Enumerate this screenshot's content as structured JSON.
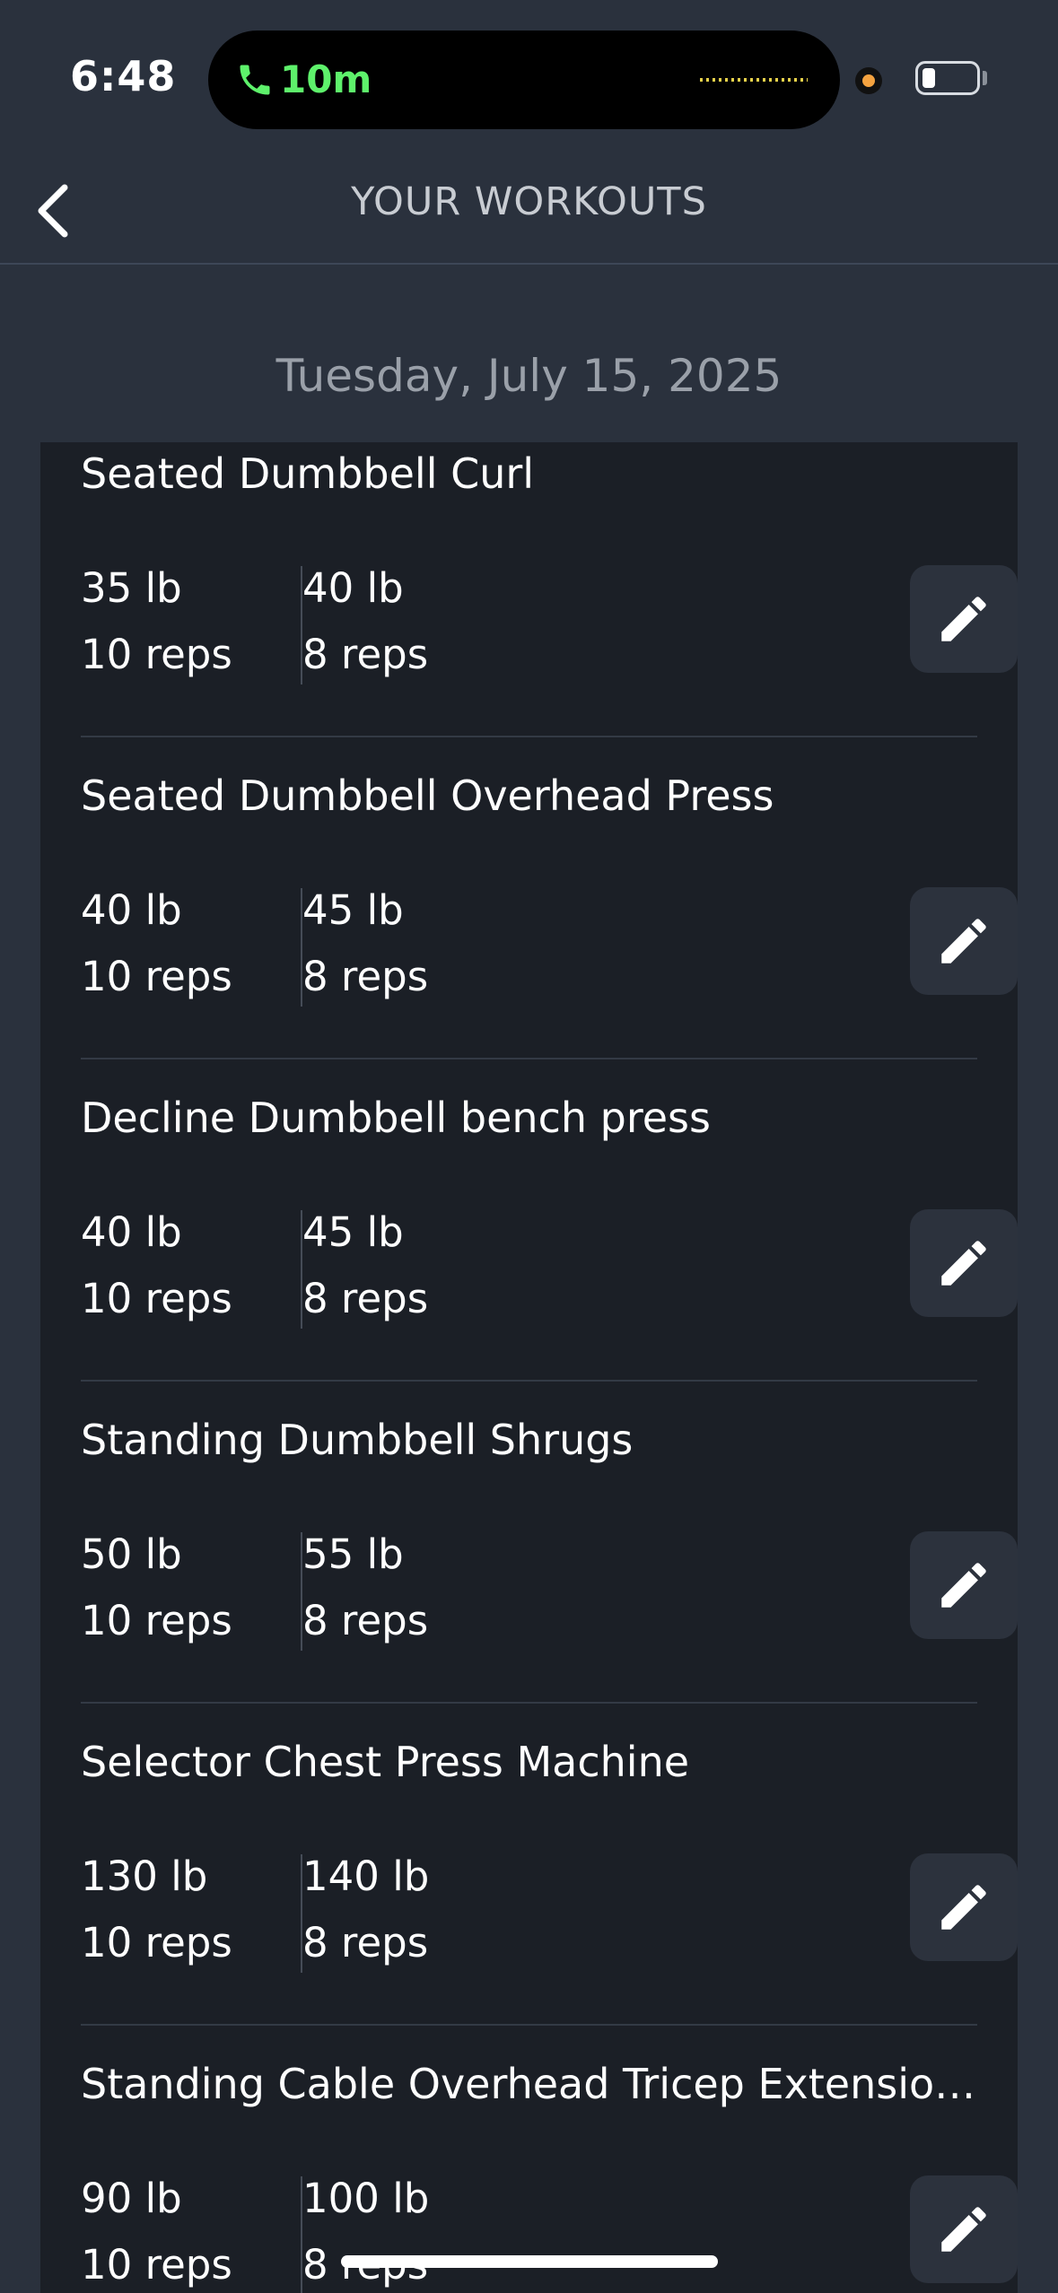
{
  "status_bar": {
    "time": "6:48",
    "call_duration": "10m"
  },
  "nav": {
    "title": "YOUR WORKOUTS"
  },
  "date": "Tuesday, July 15, 2025",
  "workouts": [
    {
      "name": "Seated Dumbbell Curl",
      "sets": [
        {
          "weight": "35 lb",
          "reps": "10 reps"
        },
        {
          "weight": "40 lb",
          "reps": "8 reps"
        }
      ]
    },
    {
      "name": "Seated Dumbbell Overhead Press",
      "sets": [
        {
          "weight": "40 lb",
          "reps": "10 reps"
        },
        {
          "weight": "45 lb",
          "reps": "8 reps"
        }
      ]
    },
    {
      "name": "Decline Dumbbell bench press",
      "sets": [
        {
          "weight": "40 lb",
          "reps": "10 reps"
        },
        {
          "weight": "45 lb",
          "reps": "8 reps"
        }
      ]
    },
    {
      "name": "Standing Dumbbell Shrugs",
      "sets": [
        {
          "weight": "50 lb",
          "reps": "10 reps"
        },
        {
          "weight": "55 lb",
          "reps": "8 reps"
        }
      ]
    },
    {
      "name": "Selector Chest Press Machine",
      "sets": [
        {
          "weight": "130 lb",
          "reps": "10 reps"
        },
        {
          "weight": "140 lb",
          "reps": "8 reps"
        }
      ]
    },
    {
      "name": "Standing Cable Overhead Tricep Extensio…",
      "sets": [
        {
          "weight": "90 lb",
          "reps": "10 reps"
        },
        {
          "weight": "100 lb",
          "reps": "8 reps"
        }
      ]
    }
  ],
  "icons": {
    "back": "chevron-left-icon",
    "edit": "pencil-icon",
    "call": "phone-icon",
    "battery": "battery-icon"
  },
  "colors": {
    "background": "#2a313d",
    "card": "#1b1f26",
    "call_green": "#5ef16b",
    "recording_dot": "#f5a340"
  }
}
